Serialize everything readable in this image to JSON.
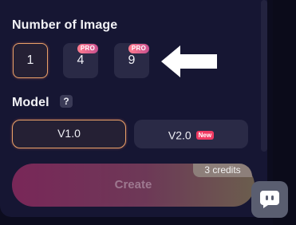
{
  "number_of_image": {
    "title": "Number of Image",
    "options": [
      {
        "label": "1",
        "selected": true,
        "badge": ""
      },
      {
        "label": "4",
        "selected": false,
        "badge": "PRO"
      },
      {
        "label": "9",
        "selected": false,
        "badge": "PRO"
      }
    ]
  },
  "model": {
    "title": "Model",
    "help_icon": "?",
    "options": [
      {
        "label": "V1.0",
        "selected": true,
        "badge": ""
      },
      {
        "label": "V2.0",
        "selected": false,
        "badge": "New"
      }
    ]
  },
  "create": {
    "label": "Create",
    "credits": "3 credits",
    "enabled": false
  },
  "icons": {
    "arrow": "right-arrow-icon",
    "chat": "chat-support-icon"
  },
  "colors": {
    "background": "#0c0c1e",
    "panel": "#161633",
    "button": "#2a2a46",
    "selected_border": "#e9a068",
    "pro_badge": "#e0638f",
    "new_badge": "#f03b63",
    "create_gradient_start": "#8a2a5e",
    "create_gradient_end": "#7a6a52"
  }
}
